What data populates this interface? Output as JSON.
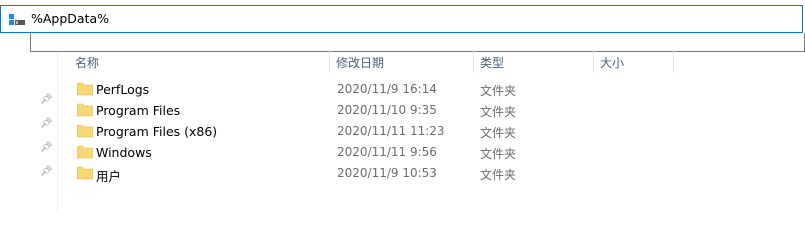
{
  "address_bar": {
    "value": "%AppData%",
    "icon": "drive-icon"
  },
  "columns": {
    "name": "名称",
    "date": "修改日期",
    "type": "类型",
    "size": "大小"
  },
  "files": [
    {
      "name": "PerfLogs",
      "date": "2020/11/9 16:14",
      "type": "文件夹"
    },
    {
      "name": "Program Files",
      "date": "2020/11/10 9:35",
      "type": "文件夹"
    },
    {
      "name": "Program Files (x86)",
      "date": "2020/11/11 11:23",
      "type": "文件夹"
    },
    {
      "name": "Windows",
      "date": "2020/11/11 9:56",
      "type": "文件夹"
    },
    {
      "name": "用户",
      "date": "2020/11/9 10:53",
      "type": "文件夹"
    }
  ],
  "colors": {
    "accent": "#0078d7",
    "folder": "#f8d775",
    "header_text": "#4c607a"
  }
}
